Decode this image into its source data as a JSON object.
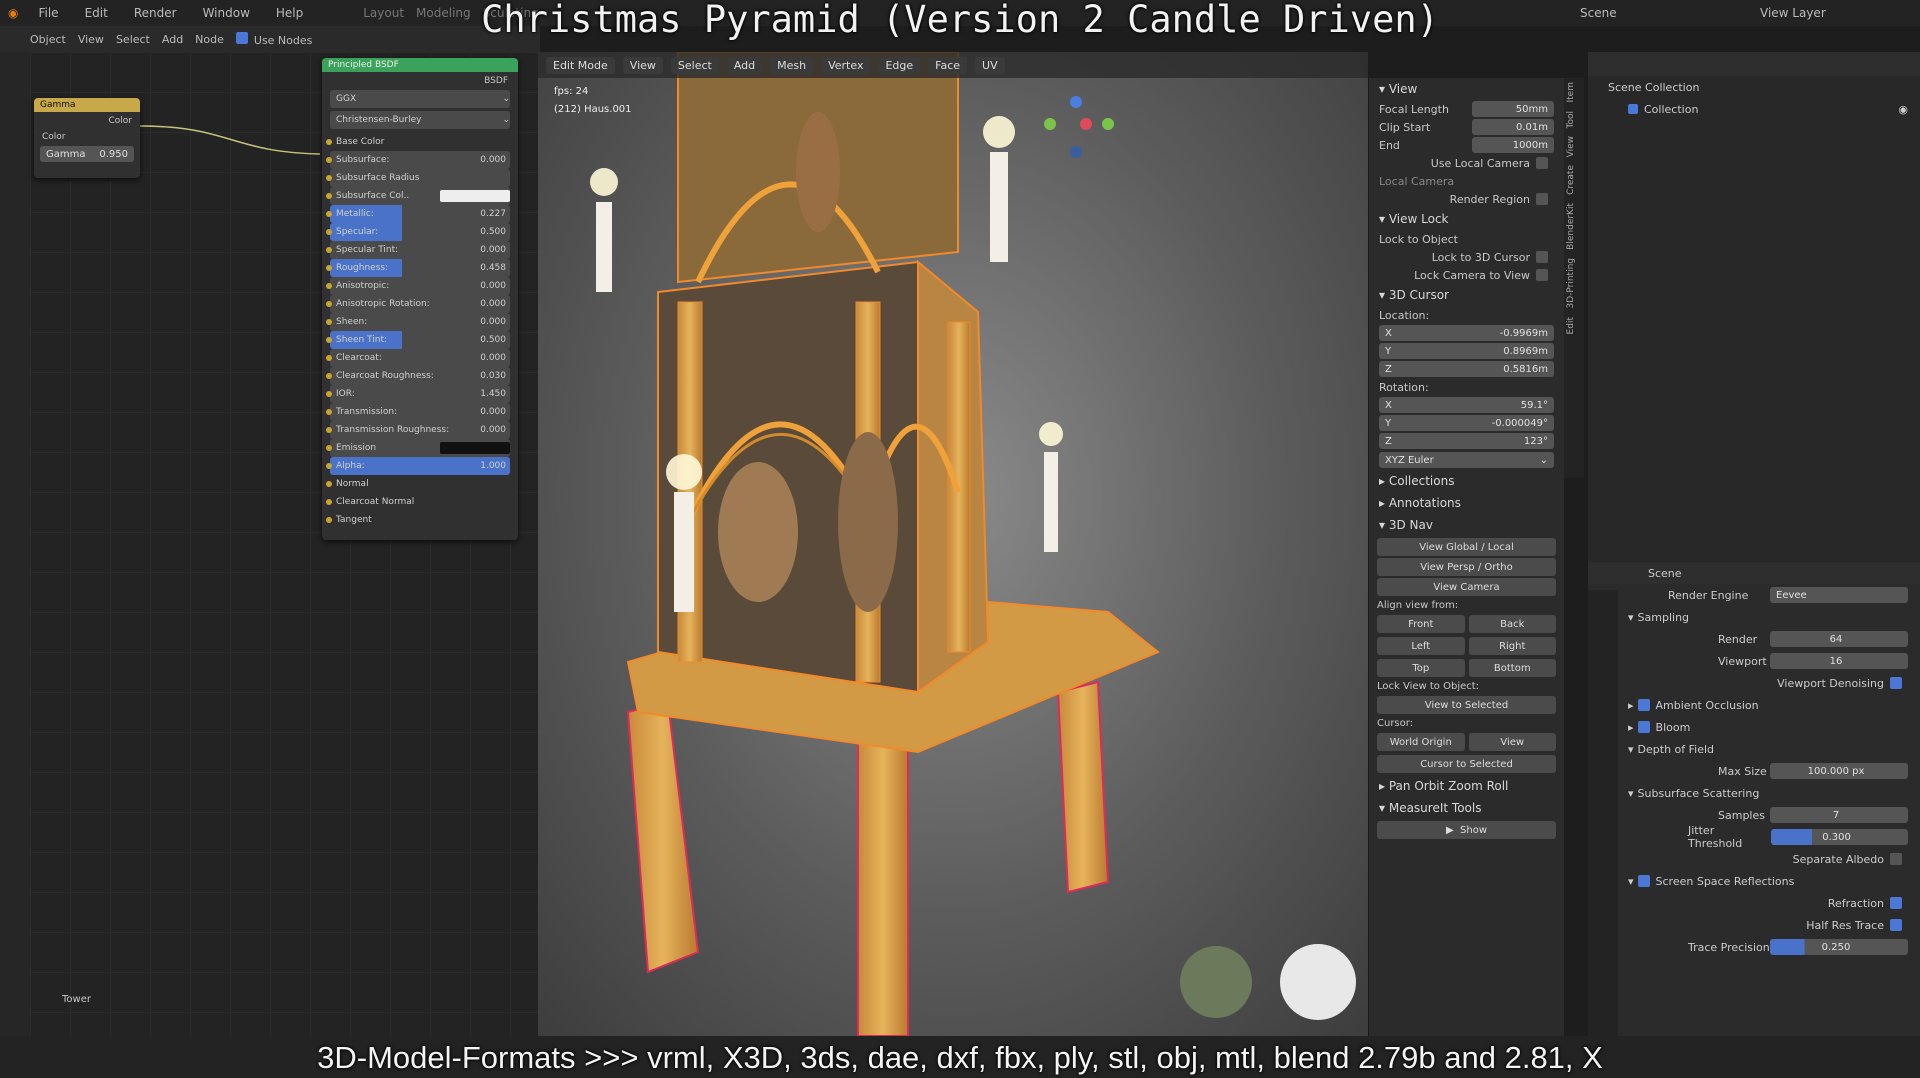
{
  "video_title": "Christmas Pyramid (Version 2 Candle Driven)",
  "subtitle": "3D-Model-Formats >>> vrml, X3D, 3ds, dae, dxf, fbx, ply, stl, obj, mtl, blend 2.79b and 2.81, X",
  "menu": [
    "File",
    "Edit",
    "Render",
    "Window",
    "Help"
  ],
  "workspace_tabs": [
    "Layout",
    "Modeling",
    "Sculpting"
  ],
  "top_right": {
    "scene": "Scene",
    "view_layer": "View Layer"
  },
  "node_header": {
    "object": "Object",
    "view": "View",
    "select": "Select",
    "add": "Add",
    "node": "Node",
    "use_nodes": "Use Nodes"
  },
  "gamma_node": {
    "title": "Gamma",
    "out": "Color",
    "in": "Color",
    "field": "Gamma",
    "value": "0.950"
  },
  "bsdf_node": {
    "title": "Principled BSDF",
    "output": "BSDF",
    "dist": "GGX",
    "sss_method": "Christensen-Burley",
    "rows": [
      {
        "label": "Base Color",
        "value": "",
        "kind": "plain"
      },
      {
        "label": "Subsurface:",
        "value": "0.000",
        "kind": "slider"
      },
      {
        "label": "Subsurface Radius",
        "value": "",
        "kind": "slider"
      },
      {
        "label": "Subsurface Col..",
        "value": "",
        "kind": "white"
      },
      {
        "label": "Metallic:",
        "value": "0.227",
        "kind": "blue"
      },
      {
        "label": "Specular:",
        "value": "0.500",
        "kind": "blue"
      },
      {
        "label": "Specular Tint:",
        "value": "0.000",
        "kind": "slider"
      },
      {
        "label": "Roughness:",
        "value": "0.458",
        "kind": "blue"
      },
      {
        "label": "Anisotropic:",
        "value": "0.000",
        "kind": "slider"
      },
      {
        "label": "Anisotropic Rotation:",
        "value": "0.000",
        "kind": "slider"
      },
      {
        "label": "Sheen:",
        "value": "0.000",
        "kind": "slider"
      },
      {
        "label": "Sheen Tint:",
        "value": "0.500",
        "kind": "blue"
      },
      {
        "label": "Clearcoat:",
        "value": "0.000",
        "kind": "slider"
      },
      {
        "label": "Clearcoat Roughness:",
        "value": "0.030",
        "kind": "slider"
      },
      {
        "label": "IOR:",
        "value": "1.450",
        "kind": "slider"
      },
      {
        "label": "Transmission:",
        "value": "0.000",
        "kind": "slider"
      },
      {
        "label": "Transmission Roughness:",
        "value": "0.000",
        "kind": "slider"
      },
      {
        "label": "Emission",
        "value": "",
        "kind": "black"
      },
      {
        "label": "Alpha:",
        "value": "1.000",
        "kind": "full"
      },
      {
        "label": "Normal",
        "value": "",
        "kind": "plain"
      },
      {
        "label": "Clearcoat Normal",
        "value": "",
        "kind": "plain"
      },
      {
        "label": "Tangent",
        "value": "",
        "kind": "plain"
      }
    ]
  },
  "tower_label": "Tower",
  "viewport": {
    "mode": "Edit Mode",
    "menus": [
      "View",
      "Select",
      "Add",
      "Mesh",
      "Vertex",
      "Edge",
      "Face",
      "UV"
    ],
    "fps": "fps: 24",
    "object_info": "(212) Haus.001"
  },
  "npanel": {
    "view_title": "View",
    "focal_label": "Focal Length",
    "focal": "50mm",
    "clip_start_label": "Clip Start",
    "clip_start": "0.01m",
    "clip_end_label": "End",
    "clip_end": "1000m",
    "use_local_camera": "Use Local Camera",
    "local_camera": "Local Camera",
    "render_region": "Render Region",
    "view_lock": "View Lock",
    "lock_to_object": "Lock to Object",
    "lock_to_cursor": "Lock to 3D Cursor",
    "lock_cam_to_view": "Lock Camera to View",
    "cursor_title": "3D Cursor",
    "location": "Location:",
    "loc": [
      {
        "a": "X",
        "v": "-0.9969m"
      },
      {
        "a": "Y",
        "v": "0.8969m"
      },
      {
        "a": "Z",
        "v": "0.5816m"
      }
    ],
    "rotation": "Rotation:",
    "rot": [
      {
        "a": "X",
        "v": "59.1°"
      },
      {
        "a": "Y",
        "v": "-0.000049°"
      },
      {
        "a": "Z",
        "v": "123°"
      }
    ],
    "euler": "XYZ Euler",
    "collections": "Collections",
    "annotations": "Annotations",
    "nav": "3D Nav",
    "view_global": "View Global / Local",
    "view_persp": "View Persp / Ortho",
    "view_camera": "View Camera",
    "align_from": "Align view from:",
    "align": [
      "Front",
      "Back",
      "Left",
      "Right",
      "Top",
      "Bottom"
    ],
    "lock_view_obj": "Lock View to Object:",
    "view_selected": "View to Selected",
    "cursor": "Cursor:",
    "world_origin": "World Origin",
    "view": "View",
    "cursor_to_sel": "Cursor to Selected",
    "pan": "Pan Orbit Zoom Roll",
    "measureit": "MeasureIt Tools",
    "show": "Show"
  },
  "vtabs": [
    "Item",
    "Tool",
    "View",
    "Create",
    "BlenderKit",
    "3D-Printing",
    "Edit"
  ],
  "outliner": {
    "root": "Scene Collection",
    "child": "Collection"
  },
  "props": {
    "scene": "Scene",
    "engine_label": "Render Engine",
    "engine": "Eevee",
    "sampling": "Sampling",
    "render_label": "Render",
    "render": "64",
    "viewport_label": "Viewport",
    "viewport": "16",
    "denoise": "Viewport Denoising",
    "ao": "Ambient Occlusion",
    "bloom": "Bloom",
    "dof": "Depth of Field",
    "max_size_label": "Max Size",
    "max_size": "100.000 px",
    "sss": "Subsurface Scattering",
    "samples_label": "Samples",
    "samples": "7",
    "jitter_label": "Jitter Threshold",
    "jitter": "0.300",
    "sep_albedo": "Separate Albedo",
    "ssr": "Screen Space Reflections",
    "refraction": "Refraction",
    "half_res": "Half Res Trace",
    "trace_label": "Trace Precision",
    "trace": "0.250"
  },
  "colors": {
    "accent": "#4a72c9",
    "select_orange": "#e8892a",
    "wood": "#d9a24a"
  }
}
